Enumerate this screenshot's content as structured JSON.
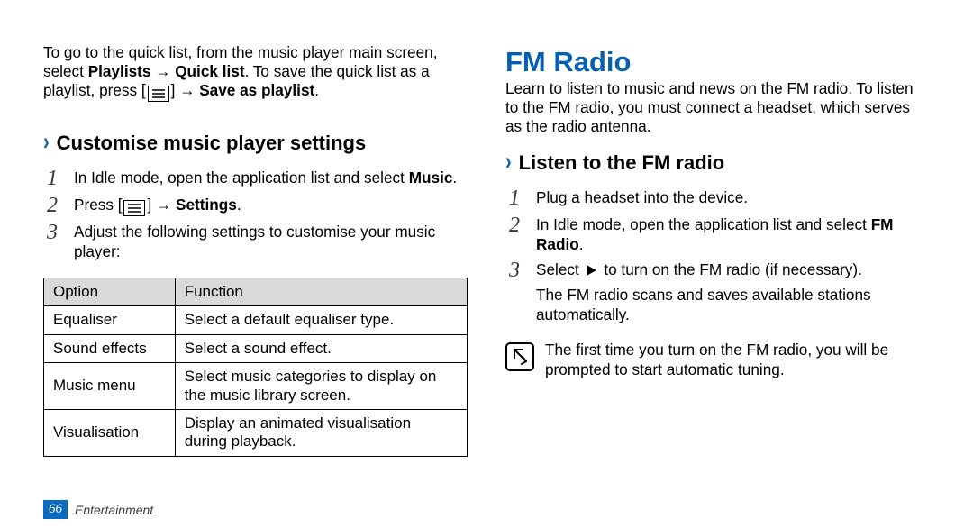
{
  "left": {
    "intro": {
      "line1a": "To go to the quick list, from the music player main screen, select ",
      "playlists": "Playlists",
      "arrow1": " → ",
      "quicklist": "Quick list",
      "line1b": ". To save the quick list as a playlist, press [",
      "line1c": "] → ",
      "saveas": "Save as playlist",
      "line1d": "."
    },
    "h2": "Customise music player settings",
    "steps": {
      "s1a": "In Idle mode, open the application list and select ",
      "s1b": "Music",
      "s1c": ".",
      "s2a": "Press [",
      "s2b": "] → ",
      "s2c": "Settings",
      "s2d": ".",
      "s3": "Adjust the following settings to customise your music player:"
    },
    "table": {
      "hOption": "Option",
      "hFunction": "Function",
      "r1o": "Equaliser",
      "r1f": "Select a default equaliser type.",
      "r2o": "Sound effects",
      "r2f": "Select a sound effect.",
      "r3o": "Music menu",
      "r3f": "Select music categories to display on the music library screen.",
      "r4o": "Visualisation",
      "r4f": "Display an animated visualisation during playback."
    },
    "footer": {
      "page": "66",
      "section": "Entertainment"
    }
  },
  "right": {
    "h1": "FM Radio",
    "intro": "Learn to listen to music and news on the FM radio. To listen to the FM radio, you must connect a headset, which serves as the radio antenna.",
    "h2": "Listen to the FM radio",
    "steps": {
      "s1": "Plug a headset into the device.",
      "s2a": "In Idle mode, open the application list and select ",
      "s2b": "FM Radio",
      "s2c": ".",
      "s3a": "Select ",
      "s3b": " to turn on the FM radio (if necessary).",
      "s3sub": "The FM radio scans and saves available stations automatically."
    },
    "note": "The first time you turn on the FM radio, you will be prompted to start automatic tuning."
  }
}
